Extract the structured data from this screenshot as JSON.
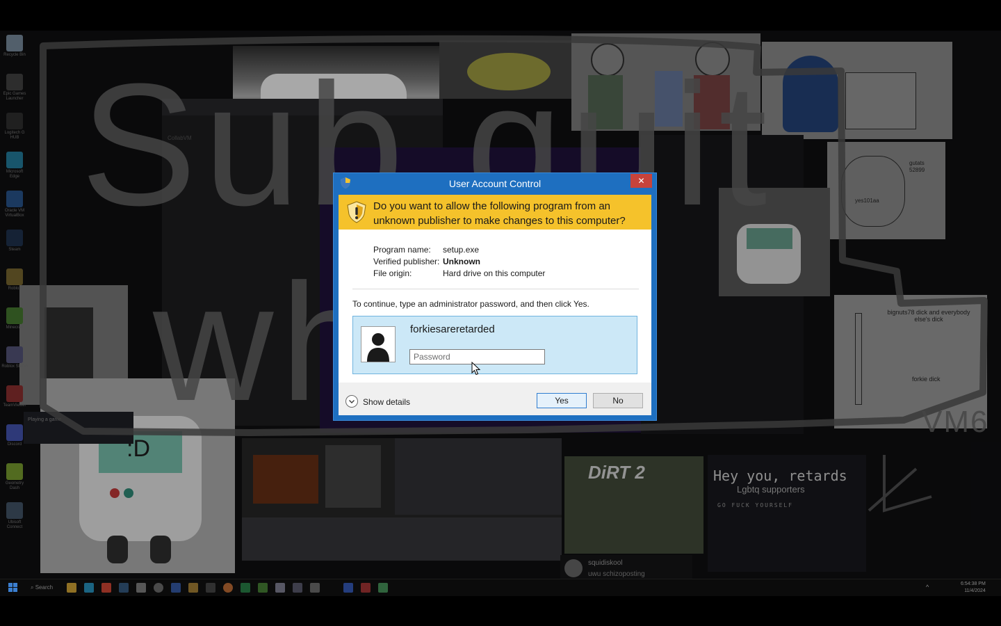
{
  "uac": {
    "title": "User Account Control",
    "close_glyph": "✕",
    "question": "Do you want to allow the following program from an unknown publisher to make changes to this computer?",
    "program_name_label": "Program name:",
    "program_name": "setup.exe",
    "publisher_label": "Verified publisher:",
    "publisher": "Unknown",
    "origin_label": "File origin:",
    "origin": "Hard drive on this computer",
    "instruction": "To continue, type an administrator password, and then click Yes.",
    "username": "forkiesareretarded",
    "password_placeholder": "Password",
    "show_details_label": "Show details",
    "yes_label": "Yes",
    "no_label": "No",
    "colors": {
      "titlebar": "#1e6fc0",
      "banner": "#f5c22b",
      "close": "#c7433b",
      "tile": "#cce8f7"
    }
  },
  "background": {
    "scrawl_line1": "Sub quit",
    "scrawl_line2": "where",
    "vm_label": "VM6",
    "meme_title": "Hey you, retards",
    "meme_subtitle": "Lgbtq supporters",
    "meme_line": "GO FUCK YOURSELF",
    "note_left": "bignuts78 dick and everybody else's dick",
    "note_right": "forkie dick",
    "tag1": "gutats",
    "tag2": "52899",
    "tag3": "yes101aa",
    "chat_user": "squidiskool",
    "chat_message": "uwu schizoposting",
    "game_logo": "DiRT 2",
    "playing_label": "Playing a game",
    "browser_tab": "CollabVM",
    "bmo_face": ":D"
  },
  "desktop_icons": [
    {
      "label": "Recycle Bin",
      "color": "#6a7a8a"
    },
    {
      "label": "Epic Games Launcher",
      "color": "#3a3a3a"
    },
    {
      "label": "Logitech G HUB",
      "color": "#2a2a2a"
    },
    {
      "label": "Microsoft Edge",
      "color": "#1f6e8a"
    },
    {
      "label": "Oracle VM VirtualBox",
      "color": "#234a7a"
    },
    {
      "label": "Steam",
      "color": "#1b2c45"
    },
    {
      "label": "Roblox",
      "color": "#6a5a2a"
    },
    {
      "label": "Minecraft",
      "color": "#3d6a2a"
    },
    {
      "label": "Roblox Studio",
      "color": "#4a4a6a"
    },
    {
      "label": "TeamViewer",
      "color": "#7a2a2a"
    },
    {
      "label": "Discord",
      "color": "#3b4a9a"
    },
    {
      "label": "Geometry Dash",
      "color": "#6a8a2a"
    },
    {
      "label": "Ubisoft Connect",
      "color": "#3a4a5a"
    }
  ],
  "taskbar": {
    "search_label": "Search",
    "clock_time": "6:54:38 PM",
    "clock_date": "11/4/2024"
  }
}
